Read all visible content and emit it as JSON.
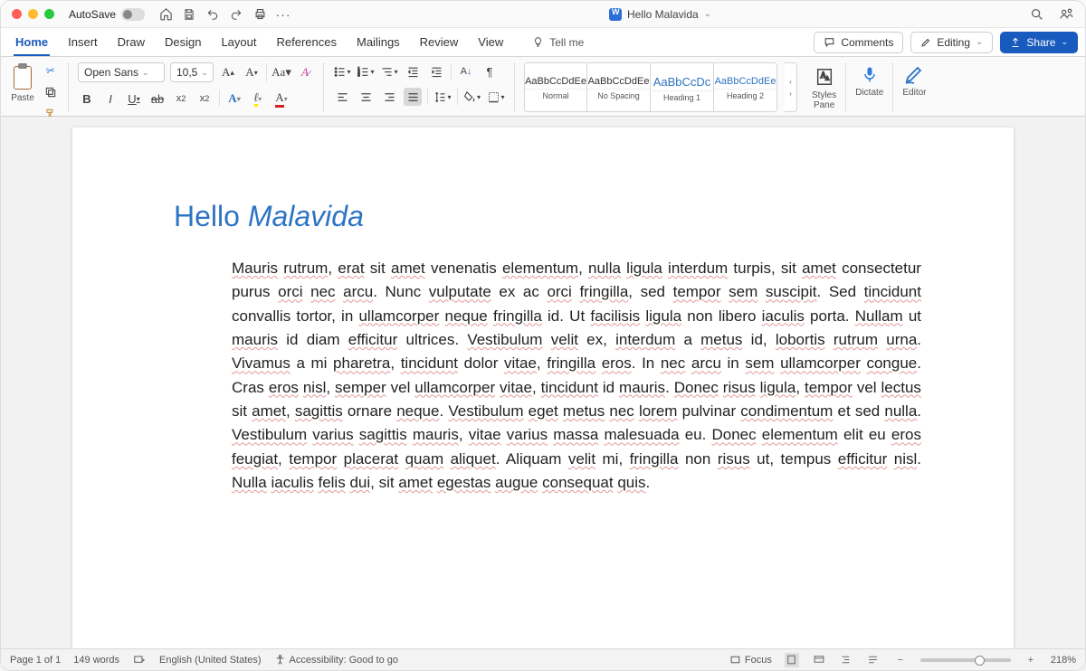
{
  "titlebar": {
    "autosave_label": "AutoSave",
    "doc_title": "Hello Malavida"
  },
  "tabs": {
    "home": "Home",
    "insert": "Insert",
    "draw": "Draw",
    "design": "Design",
    "layout": "Layout",
    "references": "References",
    "mailings": "Mailings",
    "review": "Review",
    "view": "View",
    "tellme": "Tell me"
  },
  "pills": {
    "comments": "Comments",
    "editing": "Editing",
    "share": "Share"
  },
  "ribbon": {
    "paste": "Paste",
    "font_name": "Open Sans",
    "font_size": "10,5",
    "styles_pane": "Styles\nPane",
    "dictate": "Dictate",
    "editor": "Editor",
    "styles": [
      {
        "sample": "AaBbCcDdEe",
        "label": "Normal",
        "cls": ""
      },
      {
        "sample": "AaBbCcDdEe",
        "label": "No Spacing",
        "cls": ""
      },
      {
        "sample": "AaBbCcDc",
        "label": "Heading 1",
        "cls": "h1"
      },
      {
        "sample": "AaBbCcDdEe",
        "label": "Heading 2",
        "cls": "h2"
      }
    ]
  },
  "document": {
    "heading_plain": "Hello ",
    "heading_italic": "Malavida",
    "body": "Mauris rutrum, erat sit amet venenatis elementum, nulla ligula interdum turpis, sit amet consectetur purus orci nec arcu. Nunc vulputate ex ac orci fringilla, sed tempor sem suscipit. Sed tincidunt convallis tortor, in ullamcorper neque fringilla id. Ut facilisis ligula non libero iaculis porta. Nullam ut mauris id diam efficitur ultrices. Vestibulum velit ex, interdum a metus id, lobortis rutrum urna. Vivamus a mi pharetra, tincidunt dolor vitae, fringilla eros. In nec arcu in sem ullamcorper congue. Cras eros nisl, semper vel ullamcorper vitae, tincidunt id mauris. Donec risus ligula, tempor vel lectus sit amet, sagittis ornare neque. Vestibulum eget metus nec lorem pulvinar condimentum et sed nulla. Vestibulum varius sagittis mauris, vitae varius massa malesuada eu. Donec elementum elit eu eros feugiat, tempor placerat quam aliquet. Aliquam velit mi, fringilla non risus ut, tempus efficitur nisl. Nulla iaculis felis dui, sit amet egestas augue consequat quis.",
    "squiggle_words": [
      "Mauris",
      "rutrum",
      "erat",
      "vulputate",
      "orci",
      "fringilla",
      "tempor",
      "sem",
      "suscipit",
      "ullamcorper",
      "neque",
      "facilisis",
      "ligula",
      "iaculis",
      "Nullam",
      "efficitur",
      "Vestibulum",
      "velit",
      "interdum",
      "metus",
      "lobortis",
      "urna",
      "Vivamus",
      "pharetra",
      "tincidunt",
      "nec",
      "arcu",
      "congue",
      "nisl",
      "semper",
      "vitae",
      "Donec",
      "risus",
      "lectus",
      "sagittis",
      "eget",
      "lorem",
      "condimentum",
      "nulla",
      "varius",
      "massa",
      "malesuada",
      "elementum",
      "eros",
      "feugiat",
      "placerat",
      "quam",
      "aliquet",
      "felis",
      "dui",
      "amet",
      "egestas",
      "augue",
      "consequat",
      "quis"
    ]
  },
  "statusbar": {
    "page": "Page 1 of 1",
    "words": "149 words",
    "lang": "English (United States)",
    "a11y": "Accessibility: Good to go",
    "focus": "Focus",
    "zoom": "218%"
  }
}
